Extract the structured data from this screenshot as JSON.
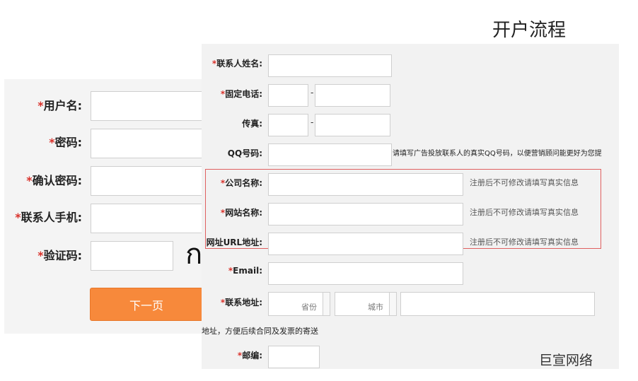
{
  "title": "开户流程",
  "brand": "巨宣网络",
  "back_form": {
    "fields": [
      {
        "required": "*",
        "label": "用户名:"
      },
      {
        "required": "*",
        "label": "密码:"
      },
      {
        "required": "*",
        "label": "确认密码:"
      },
      {
        "required": "*",
        "label": "联系人手机:"
      },
      {
        "required": "*",
        "label": "验证码:"
      }
    ],
    "captcha_text": "ก",
    "next_button": "下一页"
  },
  "front_form": {
    "contact_name": {
      "required": "*",
      "label": "联系人姓名:"
    },
    "phone": {
      "required": "*",
      "label": "固定电话:",
      "separator": "-"
    },
    "fax": {
      "label": "传真:",
      "separator": "-"
    },
    "qq": {
      "label": "QQ号码:",
      "hint": "请填写广告投放联系人的真实QQ号码，以便营销顾问能更好为您提"
    },
    "company": {
      "required": "*",
      "label": "公司名称:",
      "hint": "注册后不可修改请填写真实信息"
    },
    "website_name": {
      "required": "*",
      "label": "网站名称:",
      "hint": "注册后不可修改请填写真实信息"
    },
    "website_url": {
      "label": "网址URL地址:",
      "hint": "注册后不可修改请填写真实信息"
    },
    "email": {
      "required": "*",
      "label": "Email:"
    },
    "address": {
      "required": "*",
      "label": "联系地址:",
      "province": "省份",
      "city": "城市",
      "note": "地址，方便后续合同及发票的寄送"
    },
    "postcode": {
      "required": "*",
      "label": "邮编:"
    }
  },
  "colors": {
    "accent_button": "#f7893b",
    "required_star": "#d9322b",
    "highlight_box": "#e06060"
  }
}
